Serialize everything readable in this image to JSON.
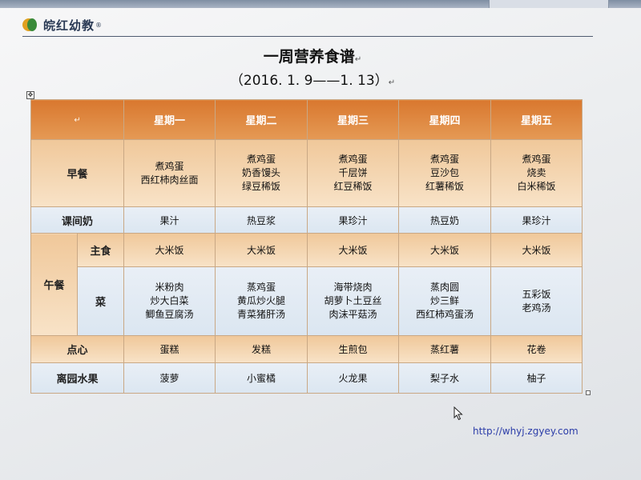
{
  "logo": {
    "text": "皖红幼教",
    "reg": "®"
  },
  "doc": {
    "title": "一周营养食谱",
    "date_range": "（2016. 1. 9——1. 13）",
    "paragraph_mark": "↵"
  },
  "table": {
    "days": [
      "星期一",
      "星期二",
      "星期三",
      "星期四",
      "星期五"
    ],
    "breakfast": {
      "label": "早餐",
      "cells": [
        [
          "煮鸡蛋",
          "西红柿肉丝面"
        ],
        [
          "煮鸡蛋",
          "奶香馒头",
          "绿豆稀饭"
        ],
        [
          "煮鸡蛋",
          "千层饼",
          "红豆稀饭"
        ],
        [
          "煮鸡蛋",
          "豆沙包",
          "红薯稀饭"
        ],
        [
          "煮鸡蛋",
          "烧卖",
          "白米稀饭"
        ]
      ]
    },
    "milk": {
      "label": "课间奶",
      "cells": [
        "果汁",
        "热豆浆",
        "果珍汁",
        "热豆奶",
        "果珍汁"
      ]
    },
    "lunch": {
      "label": "午餐",
      "staple": {
        "label": "主食",
        "cells": [
          "大米饭",
          "大米饭",
          "大米饭",
          "大米饭",
          "大米饭"
        ]
      },
      "dish": {
        "label": "菜",
        "cells": [
          [
            "米粉肉",
            "炒大白菜",
            "鲫鱼豆腐汤"
          ],
          [
            "蒸鸡蛋",
            "黄瓜炒火腿",
            "青菜猪肝汤"
          ],
          [
            "海带烧肉",
            "胡萝卜土豆丝",
            "肉沫平菇汤"
          ],
          [
            "蒸肉圆",
            "炒三鲜",
            "西红柿鸡蛋汤"
          ],
          [
            "五彩饭",
            "老鸡汤"
          ]
        ]
      }
    },
    "snack": {
      "label": "点心",
      "cells": [
        "蛋糕",
        "发糕",
        "生煎包",
        "蒸红薯",
        "花卷"
      ]
    },
    "fruit": {
      "label": "离园水果",
      "cells": [
        "菠萝",
        "小蜜橘",
        "火龙果",
        "梨子水",
        "柚子"
      ]
    }
  },
  "footer": {
    "url": "http://whyj.zgyey.com"
  },
  "colors": {
    "header_orange": "#d9782f",
    "row_beige": "#f3d2ab",
    "row_blue": "#e2eaf3",
    "url_blue": "#2b3ca8"
  }
}
